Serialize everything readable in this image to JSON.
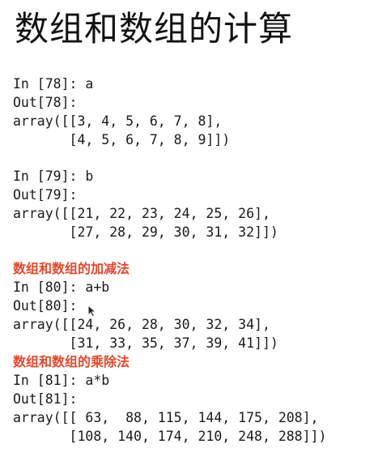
{
  "title": "数组和数组的计算",
  "cells": [
    {
      "input": "In [78]: a",
      "output_label": "Out[78]:",
      "result": [
        "array([[3, 4, 5, 6, 7, 8],",
        "       [4, 5, 6, 7, 8, 9]])"
      ]
    },
    {
      "input": "In [79]: b",
      "output_label": "Out[79]:",
      "result": [
        "array([[21, 22, 23, 24, 25, 26],",
        "       [27, 28, 29, 30, 31, 32]])"
      ]
    },
    {
      "heading": "数组和数组的加减法",
      "input": "In [80]: a+b",
      "output_label": "Out[80]:",
      "result": [
        "array([[24, 26, 28, 30, 32, 34],",
        "       [31, 33, 35, 37, 39, 41]])"
      ]
    },
    {
      "heading": "数组和数组的乘除法",
      "input": "In [81]: a*b",
      "output_label": "Out[81]:",
      "result": [
        "array([[ 63,  88, 115, 144, 175, 208],",
        "       [108, 140, 174, 210, 248, 288]])"
      ]
    }
  ],
  "colors": {
    "heading": "#e8472b",
    "text": "#1a1a1a",
    "background": "#ffffff"
  }
}
